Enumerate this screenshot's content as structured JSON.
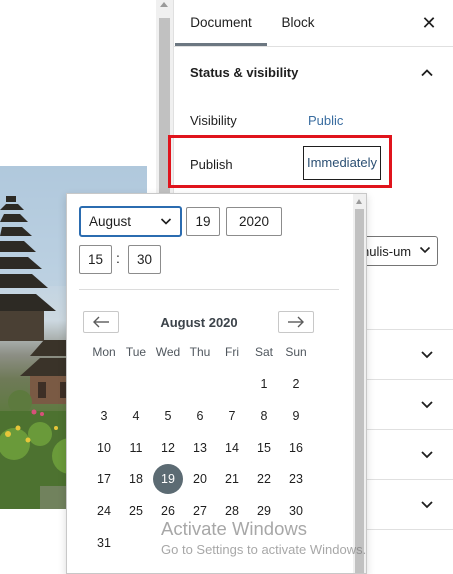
{
  "sidebar": {
    "tabs": [
      {
        "label": "Document",
        "active": true
      },
      {
        "label": "Block",
        "active": false
      }
    ],
    "close_icon": "close-icon",
    "panel": {
      "title": "Status & visibility",
      "expanded": true,
      "visibility_label": "Visibility",
      "visibility_value": "Public",
      "publish_label": "Publish",
      "publish_value": "Immediately",
      "author_value": "nulis-um"
    },
    "collapsed_sections": 4
  },
  "date_picker": {
    "month": "August",
    "day": "19",
    "year": "2020",
    "hour": "15",
    "minute": "30",
    "time_separator": ":",
    "calendar_caption": "August 2020",
    "weekdays": [
      "Mon",
      "Tue",
      "Wed",
      "Thu",
      "Fri",
      "Sat",
      "Sun"
    ],
    "first_weekday_index": 5,
    "days_in_month": 31,
    "selected_day": 19,
    "selected_color": "#5c6b73",
    "prev_icon": "arrow-left-icon",
    "next_icon": "arrow-right-icon"
  },
  "watermark": {
    "title": "Activate Windows",
    "subtitle": "Go to Settings to activate Windows."
  },
  "colors": {
    "highlight": "#e0141c",
    "focus": "#2b6cb0",
    "link": "#3a6da0"
  }
}
